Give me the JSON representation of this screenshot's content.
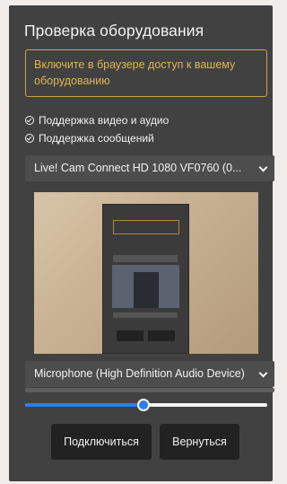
{
  "dialog": {
    "title": "Проверка оборудования",
    "warning": "Включите в браузере доступ к вашему оборудованию",
    "checks": [
      {
        "label": "Поддержка видео и аудио",
        "icon": "check-circle-icon"
      },
      {
        "label": "Поддержка сообщений",
        "icon": "check-circle-icon"
      }
    ],
    "camera_select": {
      "value": "Live! Cam Connect HD 1080 VF0760 (0..."
    },
    "mic_select": {
      "value": "Microphone (High Definition Audio Device)"
    },
    "volume": {
      "level": 0.49
    },
    "buttons": {
      "connect": "Подключиться",
      "back": "Вернуться"
    }
  },
  "colors": {
    "background": "#efece9",
    "panel": "#414141",
    "warning": "#e1b451",
    "accent": "#2f7bef",
    "button": "#222222"
  }
}
